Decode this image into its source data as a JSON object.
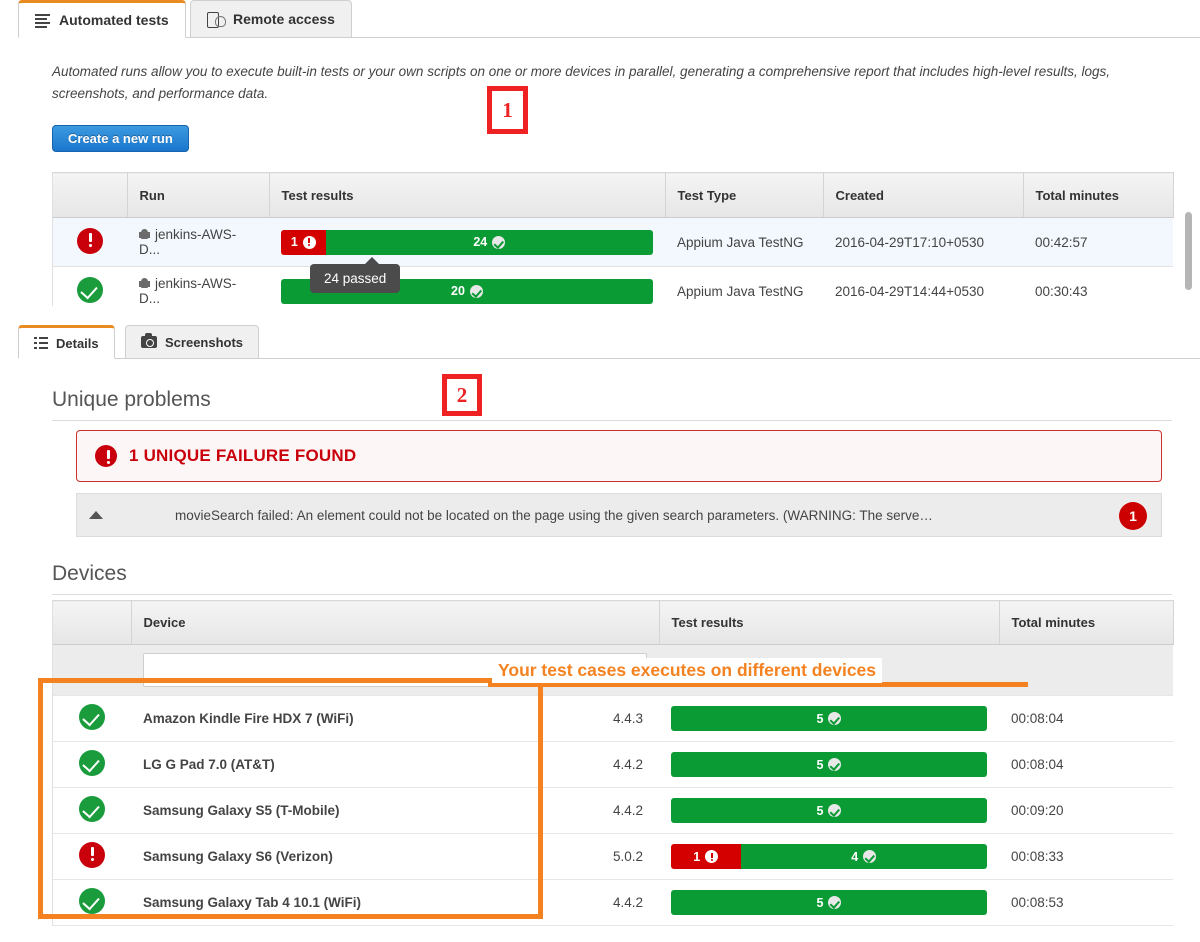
{
  "top_tabs": [
    {
      "label": "Automated tests",
      "icon": "list-lines-icon",
      "active": true
    },
    {
      "label": "Remote access",
      "icon": "phone-hand-icon",
      "active": false
    }
  ],
  "intro_text": "Automated runs allow you to execute built-in tests or your own scripts on one or more devices in parallel, generating a comprehensive report that includes high-level results, logs, screenshots, and performance data.",
  "create_run_button": "Create a new run",
  "annotations": [
    {
      "label": "1"
    },
    {
      "label": "2"
    }
  ],
  "annotation_note": "Your test cases executes on different devices",
  "runs_table": {
    "columns": [
      "",
      "Run",
      "Test results",
      "Test Type",
      "Created",
      "Total minutes"
    ],
    "rows": [
      {
        "status": "error",
        "run": "jenkins-AWS-D...",
        "failed": "1",
        "passed": "24",
        "fail_pct": 12,
        "test_type": "Appium Java TestNG",
        "created": "2016-04-29T17:10+0530",
        "total_minutes": "00:42:57",
        "highlight": true
      },
      {
        "status": "ok",
        "run": "jenkins-AWS-D...",
        "failed": "",
        "passed": "20",
        "fail_pct": 0,
        "test_type": "Appium Java TestNG",
        "created": "2016-04-29T14:44+0530",
        "total_minutes": "00:30:43",
        "highlight": false
      }
    ]
  },
  "tooltip": "24 passed",
  "detail_tabs": [
    {
      "label": "Details",
      "icon": "list-icon",
      "active": true
    },
    {
      "label": "Screenshots",
      "icon": "camera-icon",
      "active": false
    }
  ],
  "unique_problems": {
    "heading": "Unique problems",
    "alert_text": "1 UNIQUE FAILURE FOUND",
    "failure_row_text": "movieSearch failed: An element could not be located on the page using the given search parameters. (WARNING: The serve…",
    "failure_count_badge": "1"
  },
  "devices": {
    "heading": "Devices",
    "columns": [
      "",
      "Device",
      "",
      "Test results",
      "Total minutes"
    ],
    "column_device": "Device",
    "column_results": "Test results",
    "column_minutes": "Total minutes",
    "rows": [
      {
        "status": "ok",
        "name": "Amazon Kindle Fire HDX 7 (WiFi)",
        "os": "4.4.3",
        "failed": "",
        "passed": "5",
        "fail_pct": 0,
        "total_minutes": "00:08:04"
      },
      {
        "status": "ok",
        "name": "LG G Pad 7.0 (AT&T)",
        "os": "4.4.2",
        "failed": "",
        "passed": "5",
        "fail_pct": 0,
        "total_minutes": "00:08:04"
      },
      {
        "status": "ok",
        "name": "Samsung Galaxy S5 (T-Mobile)",
        "os": "4.4.2",
        "failed": "",
        "passed": "5",
        "fail_pct": 0,
        "total_minutes": "00:09:20"
      },
      {
        "status": "error",
        "name": "Samsung Galaxy S6 (Verizon)",
        "os": "5.0.2",
        "failed": "1",
        "passed": "4",
        "fail_pct": 22,
        "total_minutes": "00:08:33"
      },
      {
        "status": "ok",
        "name": "Samsung Galaxy Tab 4 10.1 (WiFi)",
        "os": "4.4.2",
        "failed": "",
        "passed": "5",
        "fail_pct": 0,
        "total_minutes": "00:08:53"
      }
    ]
  },
  "colors": {
    "accent_orange": "#e98b21",
    "annotation_orange": "#f58220",
    "annotation_red": "#ee2222",
    "pass_green": "#0b9b35",
    "fail_red": "#d40000",
    "button_blue": "#1a76cc"
  }
}
